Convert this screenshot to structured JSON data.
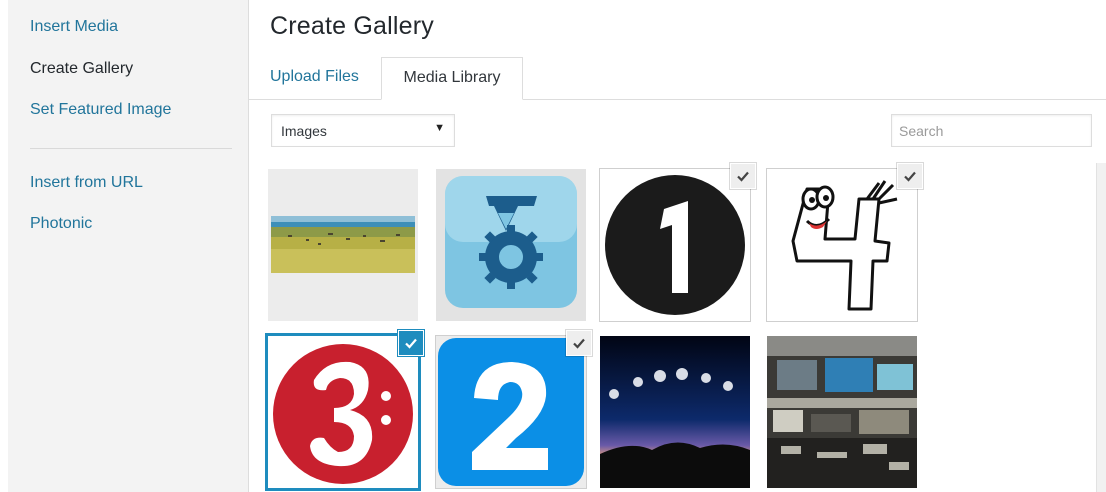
{
  "sidebar": {
    "items": [
      {
        "label": "Insert Media"
      },
      {
        "label": "Create Gallery"
      },
      {
        "label": "Set Featured Image"
      },
      {
        "label": "Insert from URL"
      },
      {
        "label": "Photonic"
      }
    ]
  },
  "header": {
    "title": "Create Gallery"
  },
  "tabs": [
    {
      "label": "Upload Files"
    },
    {
      "label": "Media Library"
    }
  ],
  "toolbar": {
    "filter_selected": "Images",
    "search_placeholder": "Search"
  },
  "attachments": [
    {
      "name": "savanna-landscape",
      "selected": false
    },
    {
      "name": "technion-logo",
      "selected": false
    },
    {
      "name": "number-1-circle",
      "selected": true
    },
    {
      "name": "cartoon-number-4",
      "selected": true
    },
    {
      "name": "number-3-red-circle",
      "selected": true,
      "details": true
    },
    {
      "name": "number-2-blue-square",
      "selected": true
    },
    {
      "name": "moon-phases-sky",
      "selected": false
    },
    {
      "name": "lab-equipment-photo",
      "selected": false
    }
  ],
  "colors": {
    "link": "#21759b",
    "accent": "#1e8cbe",
    "sidebar_bg": "#f3f3f3"
  }
}
